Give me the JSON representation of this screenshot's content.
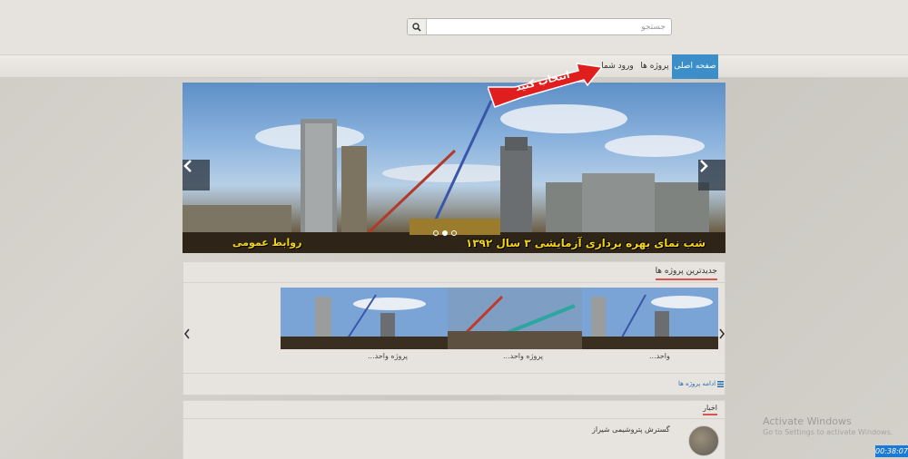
{
  "search": {
    "placeholder": "جستجو",
    "icon": "search-icon"
  },
  "nav": {
    "home": "صفحه اصلی",
    "projects": "پروژه ها",
    "login": "ورود شما"
  },
  "callout": {
    "text": "انتخاب کنید"
  },
  "slider": {
    "caption": "شب نمای بهره برداری آزمایشی ۳ سال ۱۳۹۲",
    "caption_left": "روابط عمومی",
    "dots": 2,
    "active_dot": 1
  },
  "latest_projects": {
    "title": "جدیدترین پروژه ها",
    "items": [
      {
        "label": "واحد..."
      },
      {
        "label": "پروژه واحد..."
      },
      {
        "label": "پروژه واحد..."
      }
    ],
    "more_link": "ادامه پروژه ها"
  },
  "news": {
    "title": "اخبار",
    "items": [
      {
        "title": "گسترش پتروشیمی شیراز"
      }
    ]
  },
  "os": {
    "watermark": "Activate Windows",
    "watermark_sub": "Go to Settings to activate Windows.",
    "clock": "00:38:07"
  }
}
